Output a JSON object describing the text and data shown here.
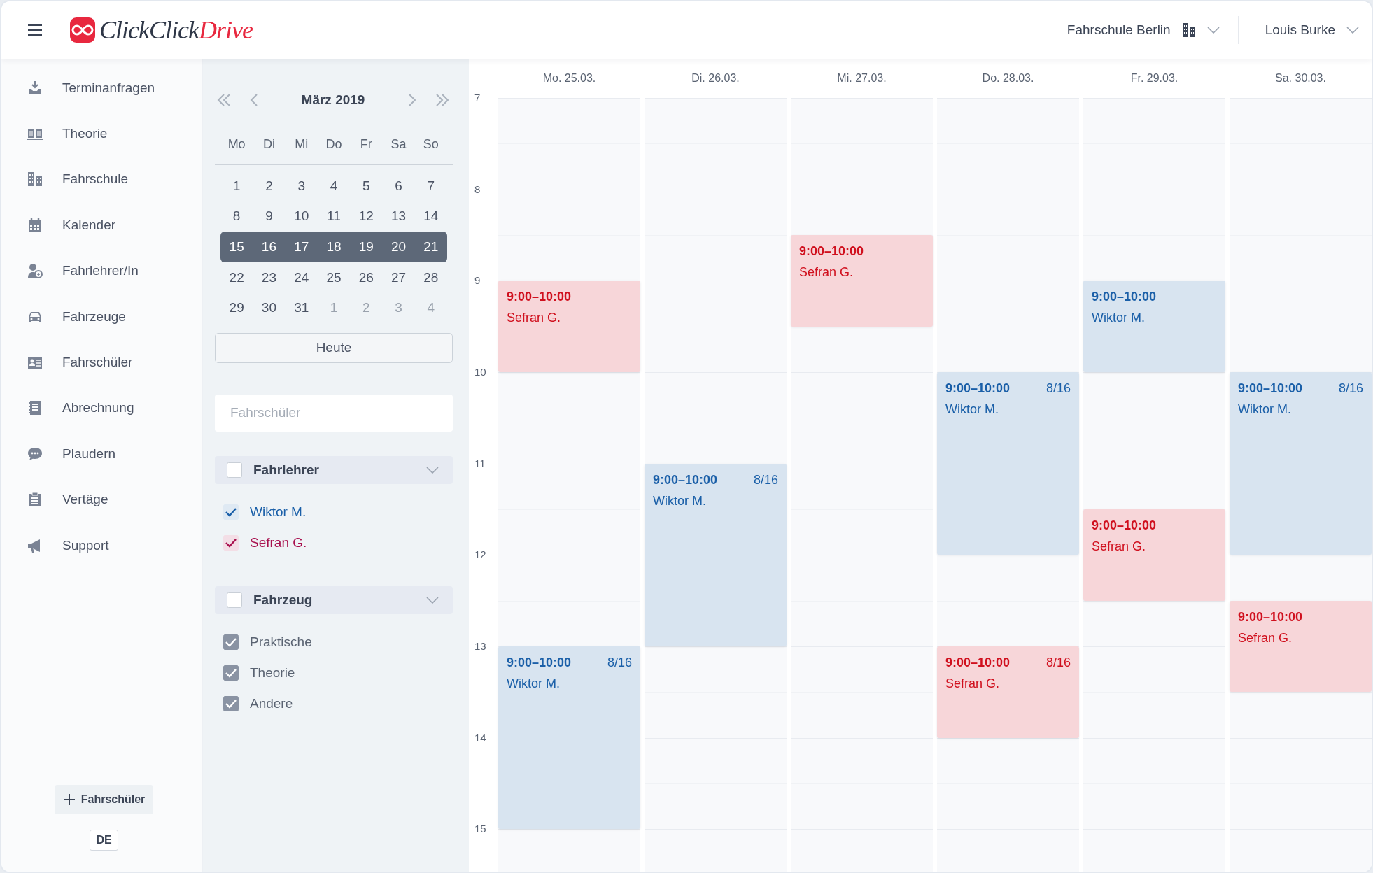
{
  "header": {
    "logo": {
      "main": "ClickClick",
      "accent": "Drive"
    },
    "school": "Fahrschule Berlin",
    "user": "Louis Burke"
  },
  "sidebar": {
    "items": [
      {
        "label": "Terminanfragen"
      },
      {
        "label": "Theorie"
      },
      {
        "label": "Fahrschule"
      },
      {
        "label": "Kalender"
      },
      {
        "label": "Fahrlehrer/In"
      },
      {
        "label": "Fahrzeuge"
      },
      {
        "label": "Fahrschüler"
      },
      {
        "label": "Abrechnung"
      },
      {
        "label": "Plaudern"
      },
      {
        "label": "Vertäge"
      },
      {
        "label": "Support"
      }
    ],
    "add_button": "Fahrschüler",
    "language": "DE"
  },
  "mini_calendar": {
    "month": "März 2019",
    "weekdays": [
      "Mo",
      "Di",
      "Mi",
      "Do",
      "Fr",
      "Sa",
      "So"
    ],
    "weeks": [
      {
        "selected": false,
        "days": [
          {
            "label": "1",
            "muted": false
          },
          {
            "label": "2",
            "muted": false
          },
          {
            "label": "3",
            "muted": false
          },
          {
            "label": "4",
            "muted": false
          },
          {
            "label": "5",
            "muted": false
          },
          {
            "label": "6",
            "muted": false
          },
          {
            "label": "7",
            "muted": false
          }
        ]
      },
      {
        "selected": false,
        "days": [
          {
            "label": "8",
            "muted": false
          },
          {
            "label": "9",
            "muted": false
          },
          {
            "label": "10",
            "muted": false
          },
          {
            "label": "11",
            "muted": false
          },
          {
            "label": "12",
            "muted": false
          },
          {
            "label": "13",
            "muted": false
          },
          {
            "label": "14",
            "muted": false
          }
        ]
      },
      {
        "selected": true,
        "days": [
          {
            "label": "15",
            "muted": false
          },
          {
            "label": "16",
            "muted": false
          },
          {
            "label": "17",
            "muted": false
          },
          {
            "label": "18",
            "muted": false
          },
          {
            "label": "19",
            "muted": false
          },
          {
            "label": "20",
            "muted": false
          },
          {
            "label": "21",
            "muted": false
          }
        ]
      },
      {
        "selected": false,
        "days": [
          {
            "label": "22",
            "muted": false
          },
          {
            "label": "23",
            "muted": false
          },
          {
            "label": "24",
            "muted": false
          },
          {
            "label": "25",
            "muted": false
          },
          {
            "label": "26",
            "muted": false
          },
          {
            "label": "27",
            "muted": false
          },
          {
            "label": "28",
            "muted": false
          }
        ]
      },
      {
        "selected": false,
        "days": [
          {
            "label": "29",
            "muted": false
          },
          {
            "label": "30",
            "muted": false
          },
          {
            "label": "31",
            "muted": false
          },
          {
            "label": "1",
            "muted": true
          },
          {
            "label": "2",
            "muted": true
          },
          {
            "label": "3",
            "muted": true
          },
          {
            "label": "4",
            "muted": true
          }
        ]
      }
    ],
    "today_button": "Heute"
  },
  "search": {
    "placeholder": "Fahrschüler"
  },
  "filters": [
    {
      "title": "Fahrlehrer",
      "checked": false,
      "options": [
        {
          "label": "Wiktor M.",
          "checked": true,
          "color": "#1a5fa8"
        },
        {
          "label": "Sefran G.",
          "checked": true,
          "color": "#a8104e"
        }
      ]
    },
    {
      "title": "Fahrzeug",
      "checked": false,
      "options": [
        {
          "label": "Praktische",
          "checked": true
        },
        {
          "label": "Theorie",
          "checked": true
        },
        {
          "label": "Andere",
          "checked": true
        }
      ]
    }
  ],
  "week": {
    "hours": [
      "7",
      "8",
      "9",
      "10",
      "11",
      "12",
      "13",
      "14",
      "15"
    ],
    "days": [
      {
        "label": "Mo. 25.03.",
        "timeline": [
          {
            "kind": "free"
          },
          {
            "kind": "free"
          },
          {
            "kind": "free"
          },
          {
            "kind": "free"
          },
          {
            "kind": "lesson",
            "long": false,
            "time": "9:00–10:00",
            "name": "Sefran G.",
            "color": "#d0101e"
          },
          {
            "kind": "free"
          },
          {
            "kind": "free"
          },
          {
            "kind": "free"
          },
          {
            "kind": "free"
          },
          {
            "kind": "free"
          },
          {
            "kind": "free"
          },
          {
            "kind": "lesson",
            "long": true,
            "time": "9:00–10:00",
            "count": "8/16",
            "name": "Wiktor M.",
            "color": "#1a5fa8"
          }
        ]
      },
      {
        "label": "Di. 26.03.",
        "timeline": [
          {
            "kind": "free"
          },
          {
            "kind": "free"
          },
          {
            "kind": "free"
          },
          {
            "kind": "free"
          },
          {
            "kind": "free"
          },
          {
            "kind": "free"
          },
          {
            "kind": "free"
          },
          {
            "kind": "free"
          },
          {
            "kind": "lesson",
            "long": true,
            "time": "9:00–10:00",
            "count": "8/16",
            "name": "Wiktor M.",
            "color": "#1a5fa8"
          }
        ]
      },
      {
        "label": "Mi. 27.03.",
        "timeline": [
          {
            "kind": "free"
          },
          {
            "kind": "free"
          },
          {
            "kind": "free"
          },
          {
            "kind": "lesson",
            "long": false,
            "time": "9:00–10:00",
            "name": "Sefran G.",
            "color": "#d0101e"
          }
        ]
      },
      {
        "label": "Do. 28.03.",
        "timeline": [
          {
            "kind": "free"
          },
          {
            "kind": "free"
          },
          {
            "kind": "free"
          },
          {
            "kind": "free"
          },
          {
            "kind": "free"
          },
          {
            "kind": "free"
          },
          {
            "kind": "lesson",
            "long": true,
            "time": "9:00–10:00",
            "count": "8/16",
            "name": "Wiktor M.",
            "color": "#1a5fa8"
          },
          {
            "kind": "free"
          },
          {
            "kind": "free"
          },
          {
            "kind": "lesson",
            "long": false,
            "time": "9:00–10:00",
            "count": "8/16",
            "name": "Sefran G.",
            "color": "#d0101e"
          }
        ]
      },
      {
        "label": "Fr. 29.03.",
        "timeline": [
          {
            "kind": "free"
          },
          {
            "kind": "free"
          },
          {
            "kind": "free"
          },
          {
            "kind": "free"
          },
          {
            "kind": "lesson",
            "long": false,
            "time": "9:00–10:00",
            "name": "Wiktor M.",
            "color": "#1a5fa8"
          },
          {
            "kind": "free"
          },
          {
            "kind": "free"
          },
          {
            "kind": "free"
          },
          {
            "kind": "lesson",
            "long": false,
            "time": "9:00–10:00",
            "name": "Sefran G.",
            "color": "#d0101e"
          }
        ]
      },
      {
        "label": "Sa. 30.03.",
        "timeline": [
          {
            "kind": "free"
          },
          {
            "kind": "free"
          },
          {
            "kind": "free"
          },
          {
            "kind": "free"
          },
          {
            "kind": "free"
          },
          {
            "kind": "free"
          },
          {
            "kind": "lesson",
            "long": true,
            "time": "9:00–10:00",
            "count": "8/16",
            "name": "Wiktor M.",
            "color": "#1a5fa8"
          },
          {
            "kind": "free"
          },
          {
            "kind": "lesson",
            "long": false,
            "time": "9:00–10:00",
            "name": "Sefran G.",
            "color": "#d0101e"
          }
        ]
      }
    ]
  }
}
